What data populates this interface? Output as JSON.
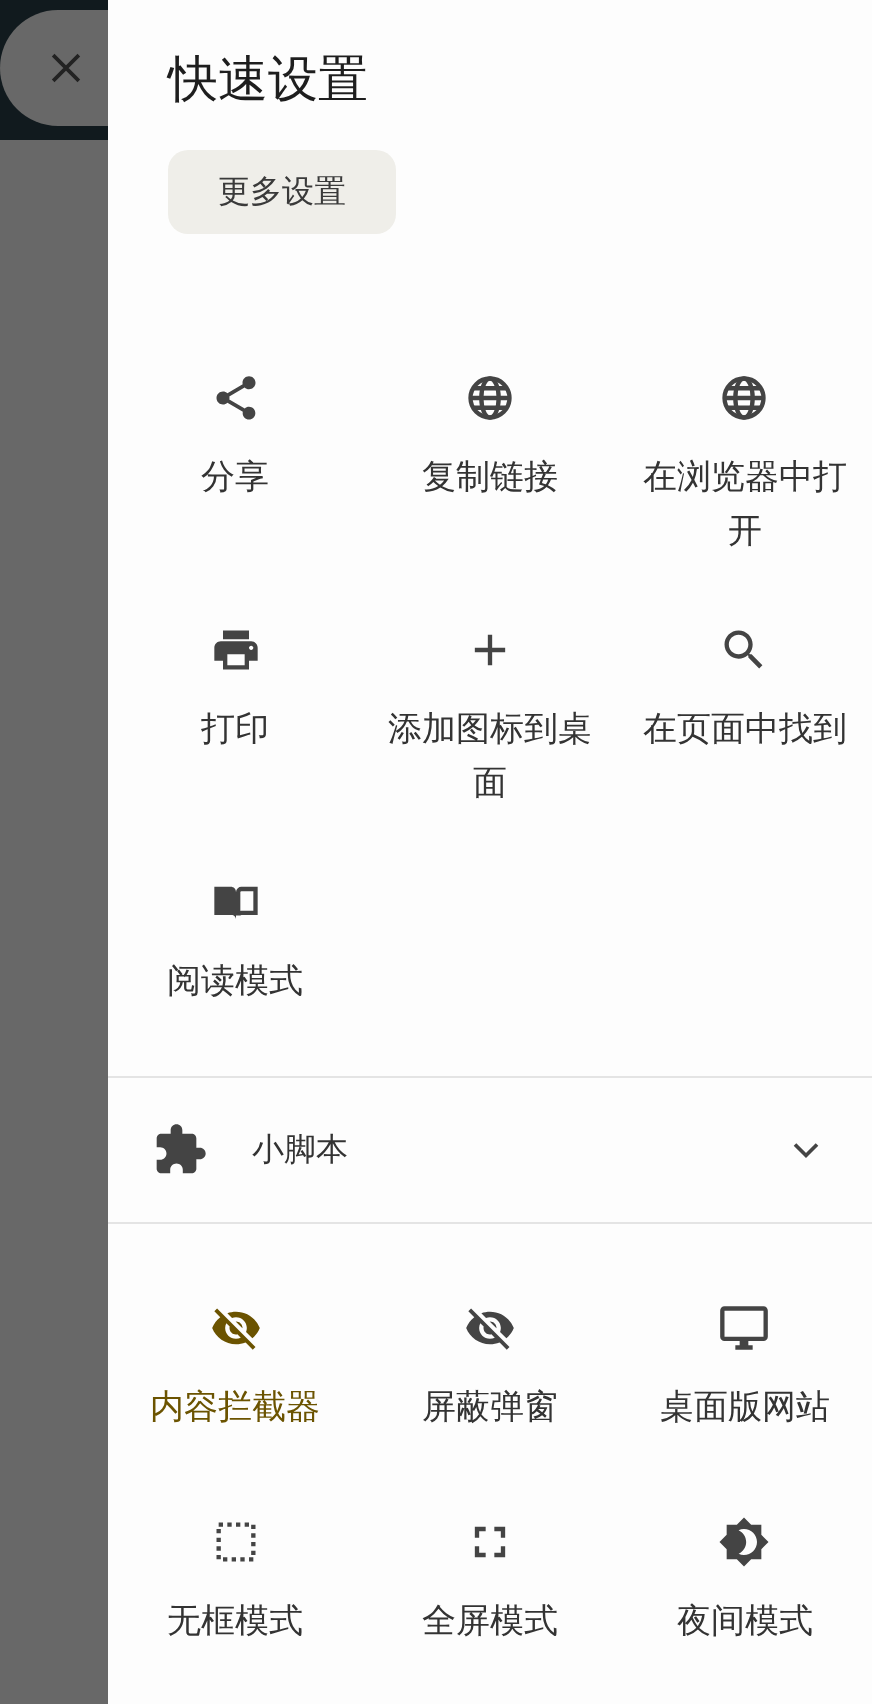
{
  "title": "快速设置",
  "more_button": {
    "label": "更多设置"
  },
  "actions": [
    {
      "kind": "share",
      "label": "分享"
    },
    {
      "kind": "globe",
      "label": "复制链接"
    },
    {
      "kind": "globe",
      "label": "在浏览器中打开"
    },
    {
      "kind": "print",
      "label": "打印"
    },
    {
      "kind": "plus",
      "label": "添加图标到桌面"
    },
    {
      "kind": "search",
      "label": "在页面中找到"
    },
    {
      "kind": "book",
      "label": "阅读模式"
    }
  ],
  "scripts": {
    "label": "小脚本",
    "expanded": false
  },
  "toggles": [
    {
      "kind": "eye-off",
      "label": "内容拦截器",
      "on": true
    },
    {
      "kind": "eye-off",
      "label": "屏蔽弹窗",
      "on": false
    },
    {
      "kind": "monitor",
      "label": "桌面版网站",
      "on": false
    },
    {
      "kind": "dotted",
      "label": "无框模式",
      "on": false
    },
    {
      "kind": "fullscreen",
      "label": "全屏模式",
      "on": false
    },
    {
      "kind": "night",
      "label": "夜间模式",
      "on": false
    }
  ]
}
